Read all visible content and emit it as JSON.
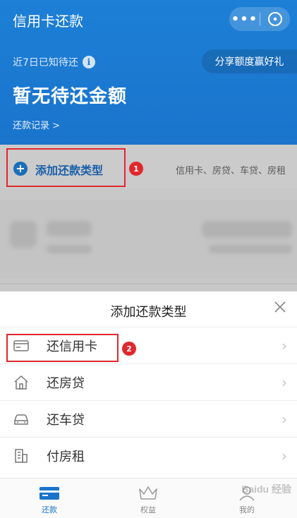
{
  "header": {
    "title": "信用卡还款",
    "more_label": "•••",
    "close_label": "✕",
    "due_label": "近7日已知待还",
    "info_label": "i",
    "share_label": "分享额度赢好礼",
    "amount_label": "暂无待还金额",
    "history_label": "还款记录 >"
  },
  "add_type": {
    "label": "添加还款类型",
    "plus": "+",
    "hint": "信用卡、房贷、车贷、房租"
  },
  "annotations": {
    "badge1": "1",
    "badge2": "2"
  },
  "sheet": {
    "title": "添加还款类型",
    "close": "×",
    "items": [
      {
        "label": "还信用卡",
        "icon": "credit-card-icon"
      },
      {
        "label": "还房贷",
        "icon": "house-icon"
      },
      {
        "label": "还车贷",
        "icon": "car-icon"
      },
      {
        "label": "付房租",
        "icon": "building-icon"
      }
    ],
    "chevron": "›"
  },
  "tabbar": {
    "tabs": [
      {
        "label": "还款",
        "icon": "card-icon",
        "active": true
      },
      {
        "label": "权益",
        "icon": "crown-icon",
        "active": false
      },
      {
        "label": "我的",
        "icon": "user-icon",
        "active": false
      }
    ]
  },
  "watermark": "Baidu 经验",
  "colors": {
    "primary": "#1a74cc",
    "annotation_red": "#e0282e",
    "overlay_gray": "#c8c8c8"
  }
}
